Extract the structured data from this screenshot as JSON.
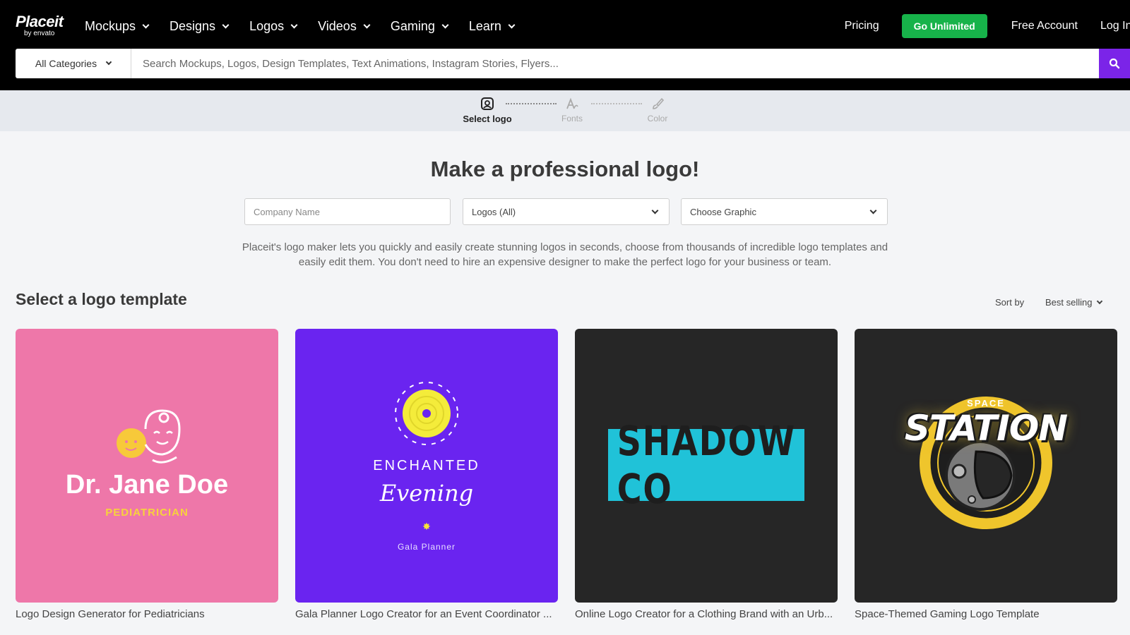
{
  "brand": {
    "name": "Placeit",
    "sub": "by envato"
  },
  "nav": {
    "items": [
      {
        "label": "Mockups"
      },
      {
        "label": "Designs"
      },
      {
        "label": "Logos"
      },
      {
        "label": "Videos"
      },
      {
        "label": "Gaming"
      },
      {
        "label": "Learn"
      }
    ],
    "pricing": "Pricing",
    "go_unlimited": "Go Unlimited",
    "free_account": "Free Account",
    "login": "Log In"
  },
  "search": {
    "category": "All Categories",
    "placeholder": "Search Mockups, Logos, Design Templates, Text Animations, Instagram Stories, Flyers..."
  },
  "stepper": {
    "steps": [
      {
        "label": "Select logo",
        "icon": "logo-select-icon",
        "active": true
      },
      {
        "label": "Fonts",
        "icon": "fonts-icon",
        "active": false
      },
      {
        "label": "Color",
        "icon": "color-brush-icon",
        "active": false
      }
    ]
  },
  "hero": {
    "title": "Make a professional logo!",
    "company_placeholder": "Company Name",
    "logos_select": "Logos (All)",
    "graphic_select": "Choose Graphic",
    "description": "Placeit's logo maker lets you quickly and easily create stunning logos in seconds, choose from thousands of incredible logo templates and easily edit them. You don't need to hire an expensive designer to make the perfect logo for your business or team."
  },
  "templates": {
    "heading": "Select a logo template",
    "sort_label": "Sort by",
    "sort_value": "Best selling",
    "cards": [
      {
        "title": "Logo Design Generator for Pediatricians",
        "logo_main": "Dr. Jane Doe",
        "logo_sub": "PEDIATRICIAN",
        "bg": "#ee77a9"
      },
      {
        "title": "Gala Planner Logo Creator for an Event Coordinator ...",
        "logo_main": "ENCHANTED",
        "logo_script": "Evening",
        "logo_sub": "Gala Planner",
        "bg": "#6a24f0"
      },
      {
        "title": "Online Logo Creator for a Clothing Brand with an Urb...",
        "logo_main": "SHADOW CO",
        "bg": "#262626"
      },
      {
        "title": "Space-Themed Gaming Logo Template",
        "logo_top": "SPACE",
        "logo_main": "STATION",
        "bg": "#262626"
      }
    ]
  },
  "colors": {
    "accent_purple": "#7b24e8",
    "accent_green": "#17b34a",
    "topbar": "#000000"
  }
}
